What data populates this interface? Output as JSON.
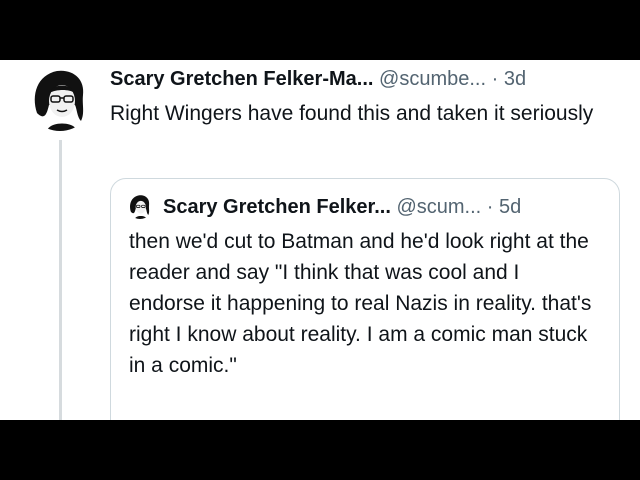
{
  "tweet": {
    "author_name": "Scary Gretchen Felker-Ma...",
    "handle": "@scumbe...",
    "separator": "·",
    "time": "3d",
    "text": "Right Wingers have found this and taken it seriously",
    "avatar_icon": "portrait-avatar-icon"
  },
  "quoted_tweet": {
    "author_name": "Scary Gretchen Felker...",
    "handle": "@scum...",
    "separator": "·",
    "time": "5d",
    "text": "then we'd cut to Batman and he'd look right at the reader and say \"I think that was cool and I endorse it happening to real Nazis in reality. that's right I know about reality. I am a comic man stuck in a comic.\"",
    "avatar_icon": "portrait-avatar-icon"
  }
}
